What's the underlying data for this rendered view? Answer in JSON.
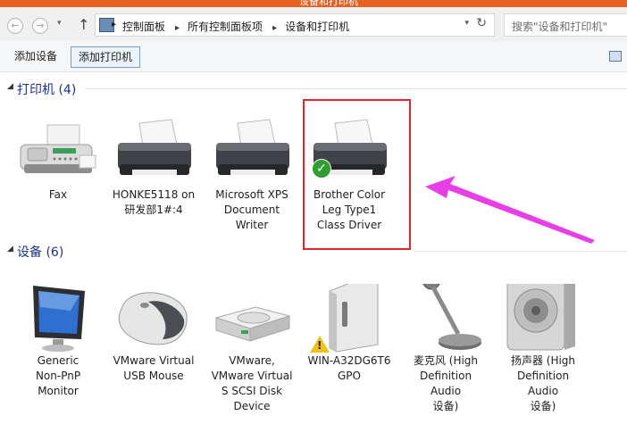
{
  "window": {
    "title": "设备和打印机"
  },
  "address": {
    "crumbs": [
      "控制面板",
      "所有控制面板项",
      "设备和打印机"
    ],
    "search_placeholder": "搜索\"设备和打印机\""
  },
  "toolbar": {
    "add_device": "添加设备",
    "add_printer": "添加打印机"
  },
  "groups": {
    "printers": {
      "title": "打印机 (4)",
      "items": [
        {
          "lines": [
            "Fax"
          ],
          "icon": "fax-icon"
        },
        {
          "lines": [
            "HONKE5118 on",
            "研发部1#:4"
          ],
          "icon": "printer-icon"
        },
        {
          "lines": [
            "Microsoft XPS",
            "Document",
            "Writer"
          ],
          "icon": "printer-icon"
        },
        {
          "lines": [
            "Brother Color",
            "Leg Type1",
            "Class Driver"
          ],
          "icon": "printer-icon",
          "default": true
        }
      ]
    },
    "devices": {
      "title": "设备 (6)",
      "items": [
        {
          "lines": [
            "Generic",
            "Non-PnP",
            "Monitor"
          ],
          "icon": "monitor-icon"
        },
        {
          "lines": [
            "VMware Virtual",
            "USB Mouse"
          ],
          "icon": "mouse-icon"
        },
        {
          "lines": [
            "VMware,",
            "VMware Virtual",
            "S SCSI Disk",
            "Device"
          ],
          "icon": "disk-icon"
        },
        {
          "lines": [
            "WIN-A32DG6T6",
            "GPO"
          ],
          "icon": "computer-icon",
          "warning": true
        },
        {
          "lines": [
            "麦克风 (High",
            "Definition Audio",
            "设备)"
          ],
          "icon": "microphone-icon"
        },
        {
          "lines": [
            "扬声器 (High",
            "Definition Audio",
            "设备)"
          ],
          "icon": "speaker-icon"
        }
      ]
    }
  },
  "colors": {
    "annotation": "#e2232a",
    "arrow": "#e83ee8",
    "group_title": "#1e3287"
  }
}
